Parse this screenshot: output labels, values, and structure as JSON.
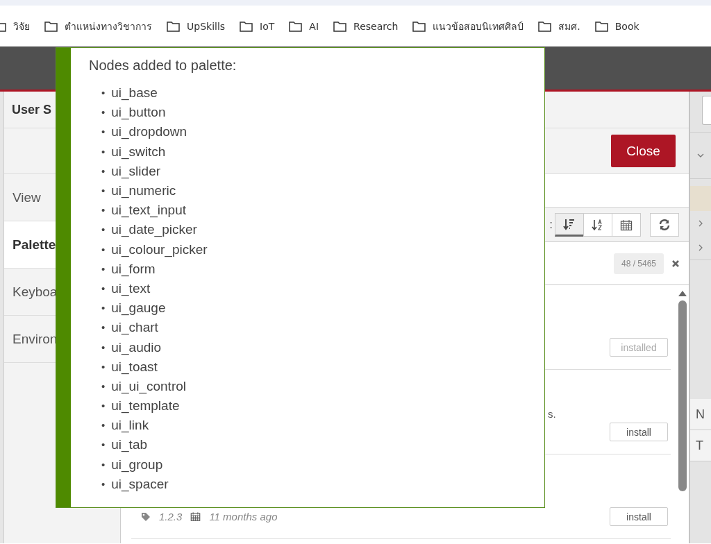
{
  "bookmarks": [
    {
      "label": "วิจัย"
    },
    {
      "label": "ตำแหน่งทางวิชาการ"
    },
    {
      "label": "UpSkills"
    },
    {
      "label": "IoT"
    },
    {
      "label": "AI"
    },
    {
      "label": "Research"
    },
    {
      "label": "แนวข้อสอบนิเทศศิลป์"
    },
    {
      "label": "สมศ."
    },
    {
      "label": "Book"
    }
  ],
  "settings": {
    "title": "User S",
    "close_button": "Close",
    "tabs": [
      {
        "label": "View",
        "selected": false
      },
      {
        "label": "Palette",
        "selected": true
      },
      {
        "label": "Keyboa",
        "selected": false
      },
      {
        "label": "Environ",
        "selected": false
      }
    ],
    "sort_label": ":",
    "sort_buttons": [
      {
        "kind": "relevance",
        "selected": true
      },
      {
        "kind": "alpha",
        "selected": false
      },
      {
        "kind": "date",
        "selected": false
      }
    ],
    "count": "48 / 5465",
    "nodes": [
      {
        "button": "installed",
        "disabled": true
      },
      {
        "text": "s.",
        "button": "install",
        "disabled": false
      },
      {
        "version": "1.2.3",
        "updated": "11 months ago",
        "button": "install",
        "disabled": false
      }
    ]
  },
  "notification": {
    "title": "Nodes added to palette:",
    "items": [
      {
        "bullet": "•",
        "name": "ui_base"
      },
      {
        "bullet": "•",
        "name": "ui_button"
      },
      {
        "bullet": "•",
        "name": "ui_dropdown"
      },
      {
        "bullet": "•",
        "name": "ui_switch"
      },
      {
        "bullet": "•",
        "name": "ui_slider"
      },
      {
        "bullet": "•",
        "name": "ui_numeric"
      },
      {
        "bullet": "•",
        "name": "ui_text_input"
      },
      {
        "bullet": "•",
        "name": "ui_date_picker"
      },
      {
        "bullet": "•",
        "name": "ui_colour_picker"
      },
      {
        "bullet": "•",
        "name": "ui_form"
      },
      {
        "bullet": "•",
        "name": "ui_text"
      },
      {
        "bullet": "•",
        "name": "ui_gauge"
      },
      {
        "bullet": "•",
        "name": "ui_chart"
      },
      {
        "bullet": "•",
        "name": "ui_audio"
      },
      {
        "bullet": "•",
        "name": "ui_toast"
      },
      {
        "bullet": "•",
        "name": "ui_ui_control"
      },
      {
        "bullet": "•",
        "name": "ui_template"
      },
      {
        "bullet": "•",
        "name": "ui_link"
      },
      {
        "bullet": "•",
        "name": "ui_tab"
      },
      {
        "bullet": "•",
        "name": "ui_group"
      },
      {
        "bullet": "•",
        "name": "ui_spacer"
      }
    ]
  },
  "sidebar": {
    "rows": [
      {
        "kind": "field"
      },
      {
        "kind": "chevron-down"
      },
      {
        "kind": "highlight"
      },
      {
        "kind": "chevron-right"
      },
      {
        "kind": "chevron-right"
      },
      {
        "kind": "label",
        "label": "N"
      },
      {
        "kind": "label",
        "label": "T"
      }
    ]
  }
}
